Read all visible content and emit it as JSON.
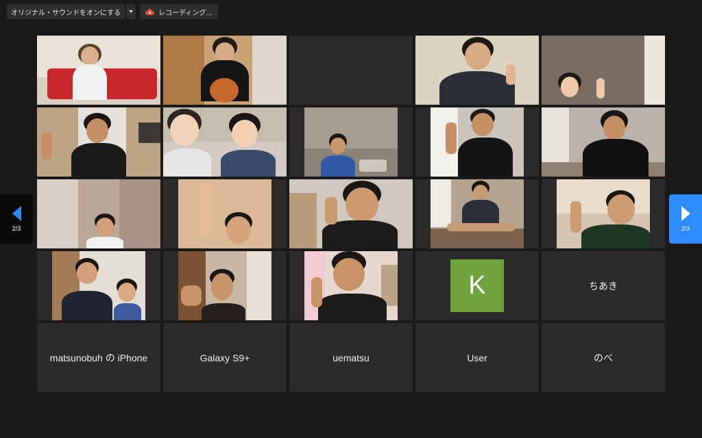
{
  "toolbar": {
    "original_sound_label": "オリジナル・サウンドをオンにする",
    "recording_label": "レコーディング..."
  },
  "navigation": {
    "prev_page_indicator": "2/3",
    "next_page_indicator": "2/3"
  },
  "colors": {
    "background": "#1a1a1a",
    "tile": "#2a2a2a",
    "accent_blue": "#2d8cff",
    "avatar_green": "#6ea33e",
    "record_red": "#e1503d"
  },
  "participants": {
    "avatar_k": {
      "initial": "K"
    },
    "name_tiles": [
      "ちあき",
      "matsunobuh の iPhone",
      "Galaxy S9+",
      "uematsu",
      "User",
      "のべ"
    ]
  }
}
